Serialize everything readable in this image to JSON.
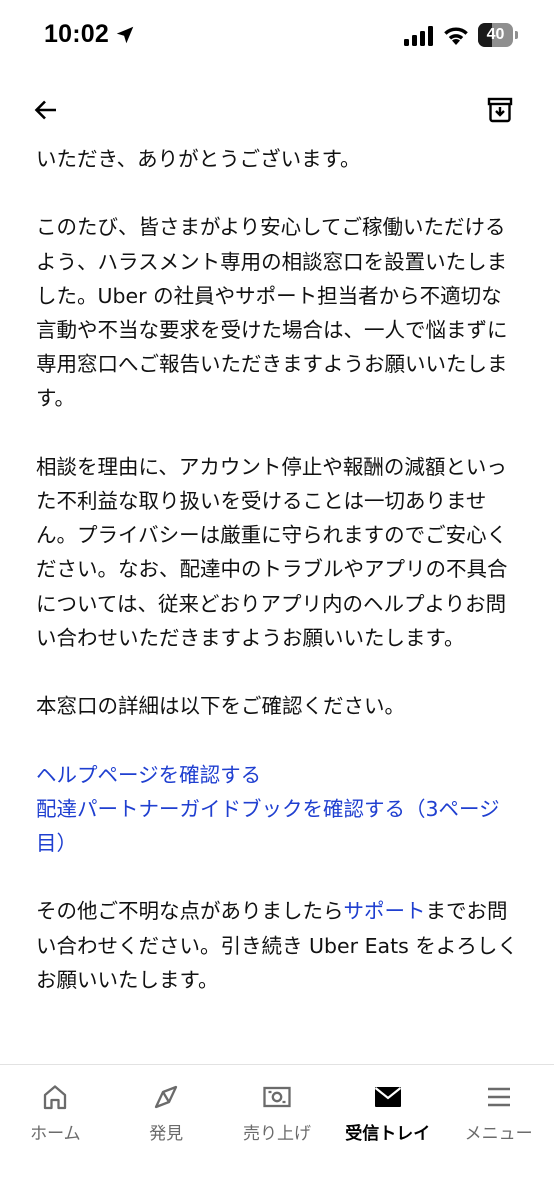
{
  "status_bar": {
    "time": "10:02",
    "battery": "40",
    "battery_level": 0.4
  },
  "header": {
    "back_icon": "arrow-left-icon",
    "archive_icon": "archive-box-icon"
  },
  "message": {
    "paragraphs": [
      "いただき、ありがとうございます。",
      "このたび、皆さまがより安心してご稼働いただけるよう、ハラスメント専用の相談窓口を設置いたしました。Uber の社員やサポート担当者から不適切な言動や不当な要求を受けた場合は、一人で悩まずに専用窓口へご報告いただきますようお願いいたします。",
      "相談を理由に、アカウント停止や報酬の減額といった不利益な取り扱いを受けることは一切ありません。プライバシーは厳重に守られますのでご安心ください。なお、配達中のトラブルやアプリの不具合については、従来どおりアプリ内のヘルプよりお問い合わせいただきますようお願いいたします。",
      "本窓口の詳細は以下をご確認ください。"
    ],
    "links": [
      "ヘルプページを確認する",
      "配達パートナーガイドブックを確認する（3ページ目）"
    ],
    "closing": {
      "before": "その他ご不明な点がありましたら",
      "link": "サポート",
      "after": "までお問い合わせください。引き続き Uber Eats をよろしくお願いいたします。"
    }
  },
  "nav": {
    "items": [
      {
        "label": "ホーム",
        "icon": "home-icon"
      },
      {
        "label": "発見",
        "icon": "compass-icon"
      },
      {
        "label": "売り上げ",
        "icon": "money-icon"
      },
      {
        "label": "受信トレイ",
        "icon": "envelope-icon",
        "active": true
      },
      {
        "label": "メニュー",
        "icon": "menu-icon"
      }
    ]
  },
  "colors": {
    "link": "#1f3fd0",
    "text": "#111111",
    "inactive_nav": "#6b6b6b"
  }
}
